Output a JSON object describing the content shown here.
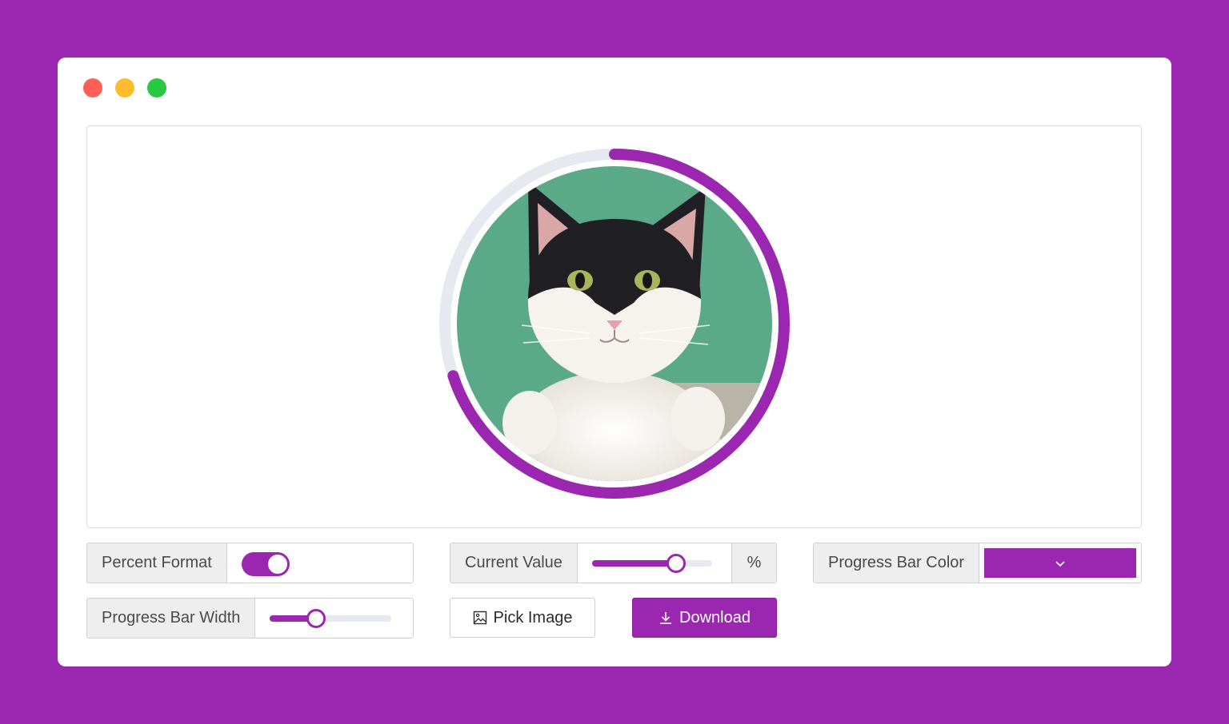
{
  "window": {
    "controls": [
      "close",
      "minimize",
      "maximize"
    ]
  },
  "preview": {
    "image_alt": "cat photo",
    "progress_value_percent": 70,
    "colors": {
      "progress": "#9b27b0",
      "track": "#e6e9f0"
    }
  },
  "controls": {
    "percent_format": {
      "label": "Percent Format",
      "enabled": true
    },
    "current_value": {
      "label": "Current Value",
      "value_percent": 70,
      "suffix": "%"
    },
    "progress_bar_color": {
      "label": "Progress Bar Color",
      "value": "#9b27b0",
      "icon": "chevron-down-icon"
    },
    "progress_bar_width": {
      "label": "Progress Bar Width",
      "value_percent": 38
    },
    "pick_image": {
      "label": "Pick Image",
      "icon": "image-icon"
    },
    "download": {
      "label": "Download",
      "icon": "download-icon"
    }
  },
  "colors": {
    "background": "#9b27b0",
    "accent": "#9b27b0",
    "window": "#ffffff"
  }
}
